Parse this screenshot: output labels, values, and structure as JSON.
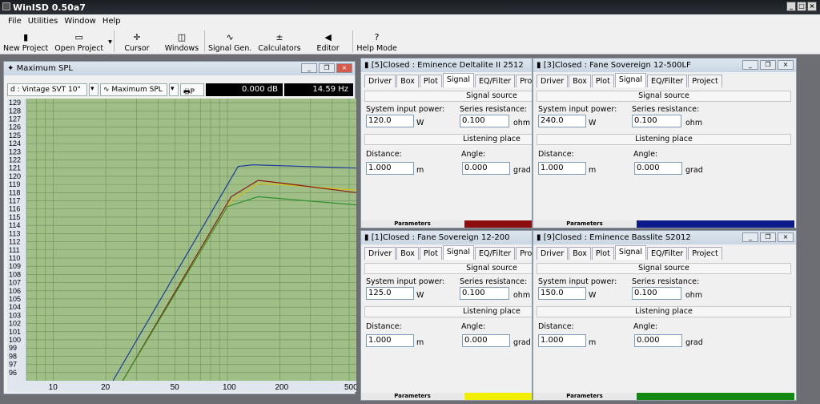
{
  "app": {
    "title": "WinISD 0.50a7"
  },
  "menu": [
    "File",
    "Utilities",
    "Window",
    "Help"
  ],
  "toolbar": [
    {
      "label": "New Project",
      "icon": "new-project-icon",
      "glyph": "▮"
    },
    {
      "label": "Open Project",
      "icon": "open-project-icon",
      "glyph": "▭"
    },
    {
      "label": "Cursor",
      "icon": "cursor-icon",
      "glyph": "✛"
    },
    {
      "label": "Windows",
      "icon": "windows-icon",
      "glyph": "◫"
    },
    {
      "label": "Signal Gen.",
      "icon": "signal-gen-icon",
      "glyph": "∿"
    },
    {
      "label": "Calculators",
      "icon": "calculators-icon",
      "glyph": "±"
    },
    {
      "label": "Editor",
      "icon": "editor-icon",
      "glyph": "◀"
    },
    {
      "label": "Help Mode",
      "icon": "help-mode-icon",
      "glyph": "?"
    }
  ],
  "chart_window": {
    "title": "Maximum SPL",
    "project_select": "d : Vintage SVT 10\"",
    "graph_select": "Maximum SPL",
    "print_label": "P",
    "readout_db": "0.000 dB",
    "readout_hz": "14.59 Hz"
  },
  "chart_data": {
    "type": "line",
    "y_ticks": [
      129,
      128,
      127,
      126,
      125,
      124,
      123,
      122,
      121,
      120,
      119,
      118,
      117,
      116,
      115,
      114,
      113,
      112,
      111,
      110,
      109,
      108,
      107,
      106,
      105,
      104,
      103,
      102,
      101,
      100,
      99,
      98,
      97,
      96
    ],
    "x_ticks": [
      "10",
      "20",
      "50",
      "100",
      "200",
      "500"
    ],
    "ylim": [
      95,
      129.5
    ],
    "xlim": [
      7,
      550
    ],
    "x_scale": "log",
    "grid": true,
    "background": "#9fbf87",
    "series": [
      {
        "color": "#1e3a9e",
        "points": [
          [
            22,
            95
          ],
          [
            115,
            121.2
          ],
          [
            140,
            121.4
          ],
          [
            550,
            121.0
          ]
        ]
      },
      {
        "color": "#d4c20e",
        "points": [
          [
            25,
            95
          ],
          [
            105,
            117
          ],
          [
            150,
            119.1
          ],
          [
            200,
            119.0
          ],
          [
            550,
            118.3
          ]
        ]
      },
      {
        "color": "#8a1a12",
        "points": [
          [
            25,
            95
          ],
          [
            105,
            117.5
          ],
          [
            150,
            119.5
          ],
          [
            200,
            119.2
          ],
          [
            550,
            118.0
          ]
        ]
      },
      {
        "color": "#2f8f2f",
        "points": [
          [
            25,
            95
          ],
          [
            100,
            116.3
          ],
          [
            150,
            117.5
          ],
          [
            250,
            117.1
          ],
          [
            550,
            116.5
          ]
        ]
      }
    ]
  },
  "tabs": [
    "Driver",
    "Box",
    "Plot",
    "Signal",
    "EQ/Filter",
    "Project"
  ],
  "labels": {
    "signal_source": "Signal source",
    "system_input_power": "System input power:",
    "series_resistance": "Series resistance:",
    "listening_place": "Listening place",
    "distance": "Distance:",
    "angle": "Angle:",
    "unit_w": "W",
    "unit_ohm": "ohm",
    "unit_m": "m",
    "unit_grad": "grad",
    "parameters": "Parameters"
  },
  "panels": [
    {
      "title": "[5]Closed : Eminence Deltalite II 2512",
      "power": "120.0",
      "resistance": "0.100",
      "distance": "1.000",
      "angle": "0.000",
      "status_color": "#8b0d0d"
    },
    {
      "title": "[3]Closed : Fane Sovereign 12-500LF",
      "power": "240.0",
      "resistance": "0.100",
      "distance": "1.000",
      "angle": "0.000",
      "status_color": "#0c1a8a"
    },
    {
      "title": "[1]Closed : Fane Sovereign 12-200",
      "power": "125.0",
      "resistance": "0.100",
      "distance": "1.000",
      "angle": "0.000",
      "status_color": "#f2ee00"
    },
    {
      "title": "[9]Closed : Eminence Basslite S2012",
      "power": "150.0",
      "resistance": "0.100",
      "distance": "1.000",
      "angle": "0.000",
      "status_color": "#128a12"
    }
  ]
}
